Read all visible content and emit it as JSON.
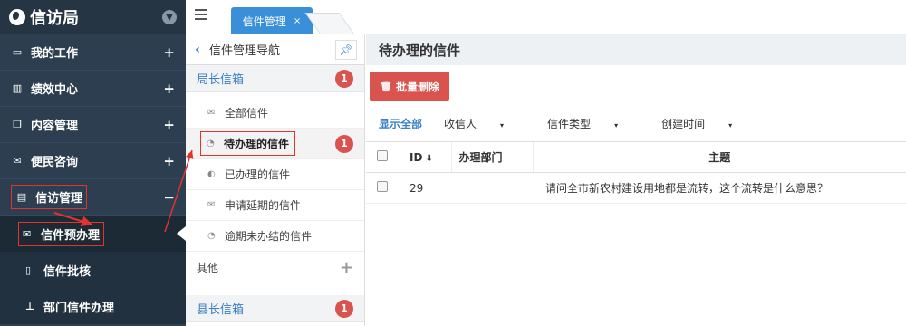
{
  "app": {
    "title": "信访局",
    "logo_icon": "globe-icon",
    "collapse_icon": "chevron-down-icon"
  },
  "sidebar": {
    "items": [
      {
        "label": "我的工作",
        "icon": "laptop-icon",
        "sign": "+"
      },
      {
        "label": "绩效中心",
        "icon": "bar-chart-icon",
        "sign": "+"
      },
      {
        "label": "内容管理",
        "icon": "copy-icon",
        "sign": "+"
      },
      {
        "label": "便民咨询",
        "icon": "envelope-icon",
        "sign": "+"
      },
      {
        "label": "信访管理",
        "icon": "inbox-icon",
        "sign": "−"
      }
    ],
    "sub_items": [
      {
        "label": "信件预办理",
        "icon": "envelope-icon"
      },
      {
        "label": "信件批核",
        "icon": "file-icon"
      },
      {
        "label": "部门信件办理",
        "icon": "sitemap-icon"
      }
    ]
  },
  "tabs": {
    "active_label": "信件管理",
    "close": "×"
  },
  "midpanel": {
    "header": "信件管理导航",
    "groups": [
      {
        "label": "局长信箱",
        "badge": "1"
      },
      {
        "label": "县长信箱",
        "badge": "1"
      }
    ],
    "items": [
      {
        "label": "全部信件",
        "icon": "envelope-icon"
      },
      {
        "label": "待办理的信件",
        "icon": "clock-icon",
        "badge": "1"
      },
      {
        "label": "已办理的信件",
        "icon": "check-icon"
      },
      {
        "label": "申请延期的信件",
        "icon": "envelope-icon"
      },
      {
        "label": "逾期未办结的信件",
        "icon": "clock-icon"
      }
    ],
    "other": {
      "label": "其他",
      "sign": "+"
    }
  },
  "main": {
    "title": "待办理的信件",
    "delete_button": "批量删除",
    "filters": [
      {
        "label": "显示全部",
        "active": true
      },
      {
        "label": "收信人",
        "caret": "▾"
      },
      {
        "label": "信件类型",
        "caret": "▾"
      },
      {
        "label": "创建时间",
        "caret": "▾"
      }
    ],
    "table": {
      "headers": {
        "id": "ID",
        "dept": "办理部门",
        "subject": "主题"
      },
      "rows": [
        {
          "id": "29",
          "dept": "",
          "subject": "请问全市新农村建设用地都是流转，这个流转是什么意思？"
        }
      ]
    }
  },
  "colors": {
    "sidebar_bg": "#2c3e50",
    "accent": "#3a8fd9",
    "danger": "#d9534f",
    "annotation": "#e0342c"
  }
}
